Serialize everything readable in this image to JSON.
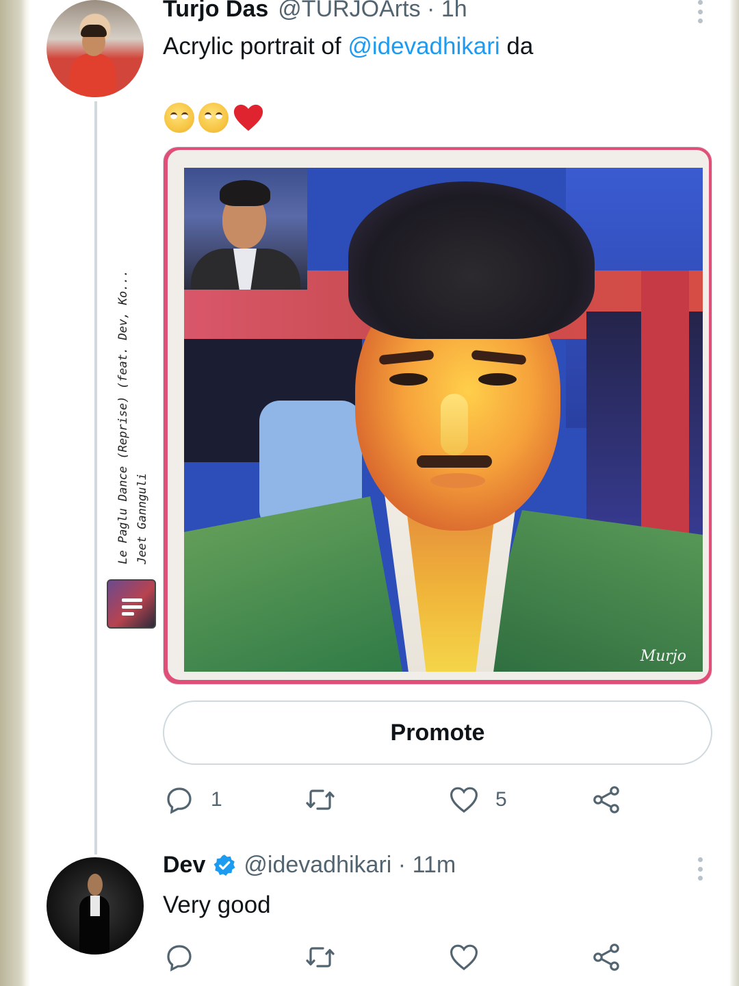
{
  "tweet": {
    "author_name": "Turjo Das",
    "author_handle": "@TURJOArts",
    "separator": "·",
    "time": "1h",
    "text_before": "Acrylic portrait of ",
    "mention": "@idevadhikari",
    "text_after": " da",
    "emojis": [
      "relieved-face-emoji",
      "relieved-face-emoji",
      "red-heart-emoji"
    ],
    "image_signature": "Murjo",
    "promote_label": "Promote",
    "reply_count": "1",
    "like_count": "5"
  },
  "reply": {
    "author_name": "Dev",
    "author_handle": "@idevadhikari",
    "separator": "·",
    "time": "11m",
    "text": "Very good",
    "verified": true
  },
  "music": {
    "line1": "Le Paglu Dance (Reprise) (feat. Dev, Ko...",
    "line2": "Jeet Gannguli"
  },
  "colors": {
    "text_primary": "#0f1419",
    "text_secondary": "#536471",
    "link": "#1d9bf0",
    "border": "#cfd9de",
    "heart": "#e0242f"
  },
  "icons": [
    "reply-icon",
    "retweet-icon",
    "like-icon",
    "share-icon",
    "verified-badge-icon",
    "more-options-icon"
  ]
}
